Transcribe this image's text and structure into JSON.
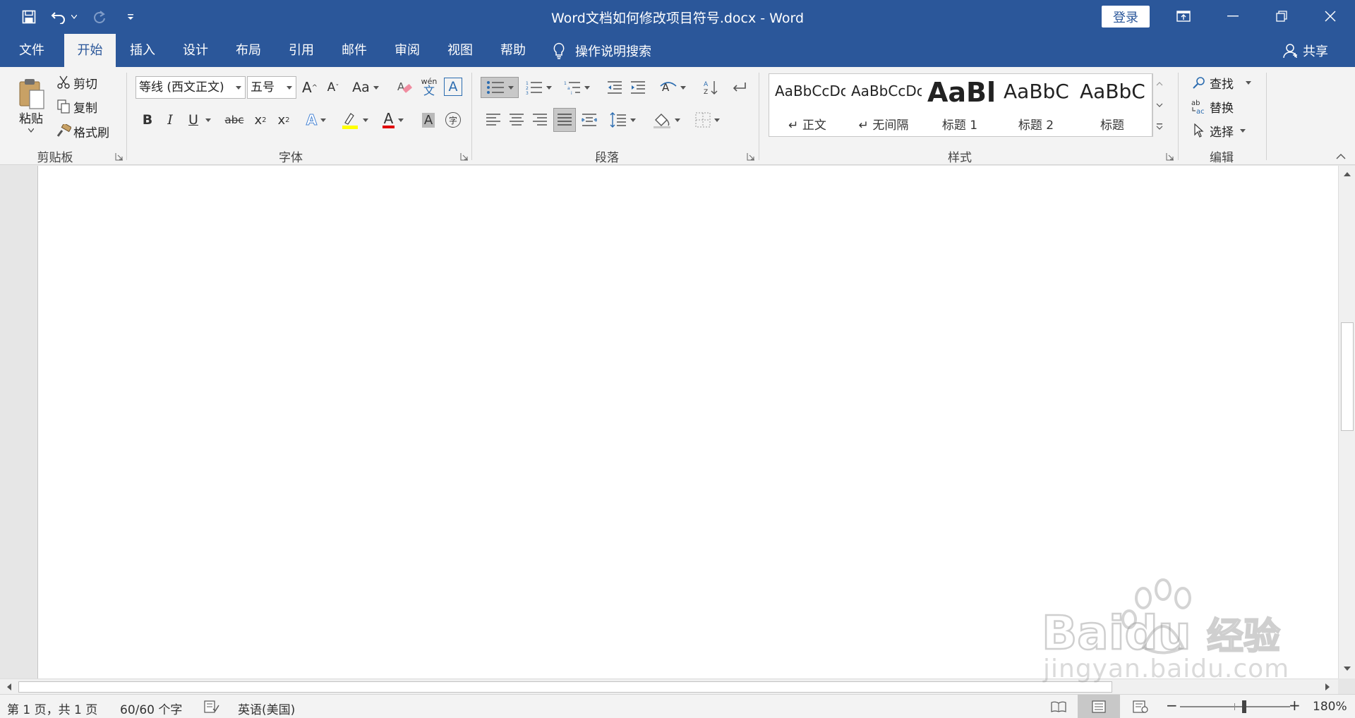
{
  "window": {
    "title": "Word文档如何修改项目符号.docx  -  Word",
    "login_label": "登录"
  },
  "tabs": [
    {
      "label": "文件"
    },
    {
      "label": "开始"
    },
    {
      "label": "插入"
    },
    {
      "label": "设计"
    },
    {
      "label": "布局"
    },
    {
      "label": "引用"
    },
    {
      "label": "邮件"
    },
    {
      "label": "审阅"
    },
    {
      "label": "视图"
    },
    {
      "label": "帮助"
    }
  ],
  "tell_me": "操作说明搜索",
  "share_label": "共享",
  "ribbon": {
    "clipboard": {
      "paste_label": "粘贴",
      "cut_label": "剪切",
      "copy_label": "复制",
      "format_painter_label": "格式刷",
      "group_label": "剪贴板"
    },
    "font": {
      "font_name": "等线 (西文正文)",
      "font_size": "五号",
      "group_label": "字体",
      "grow_label": "A",
      "shrink_label": "A",
      "case_label": "Aa",
      "bold_label": "B",
      "italic_label": "I",
      "underline_label": "U",
      "strike_label": "abc",
      "subscript_label": "x",
      "superscript_label": "x",
      "effects_label": "A",
      "color_label": "A",
      "shading_label": "A",
      "phonetic_top": "wén",
      "phonetic_bottom": "文",
      "border_label": "A",
      "enclose_label": "字",
      "font_color": "#e00000",
      "highlight_color": "#ffff00"
    },
    "paragraph": {
      "group_label": "段落"
    },
    "styles": {
      "group_label": "样式",
      "items": [
        {
          "sample": "AaBbCcDc",
          "name": "↵ 正文"
        },
        {
          "sample": "AaBbCcDc",
          "name": "↵ 无间隔"
        },
        {
          "sample": "AaBl",
          "name": "标题 1"
        },
        {
          "sample": "AaBbC",
          "name": "标题 2"
        },
        {
          "sample": "AaBbC",
          "name": "标题"
        }
      ]
    },
    "editing": {
      "find_label": "查找",
      "replace_label": "替换",
      "select_label": "选择",
      "group_label": "编辑"
    }
  },
  "status": {
    "page": "第 1 页，共 1 页",
    "words": "60/60 个字",
    "language": "英语(美国)",
    "zoom": "180%",
    "zoom_minus": "−",
    "zoom_plus": "+"
  },
  "watermark": {
    "brand": "Baidu",
    "brand_cn": "经验",
    "url": "jingyan.baidu.com"
  },
  "colors": {
    "accent": "#2b579a",
    "ribbon_bg": "#f3f3f3"
  }
}
